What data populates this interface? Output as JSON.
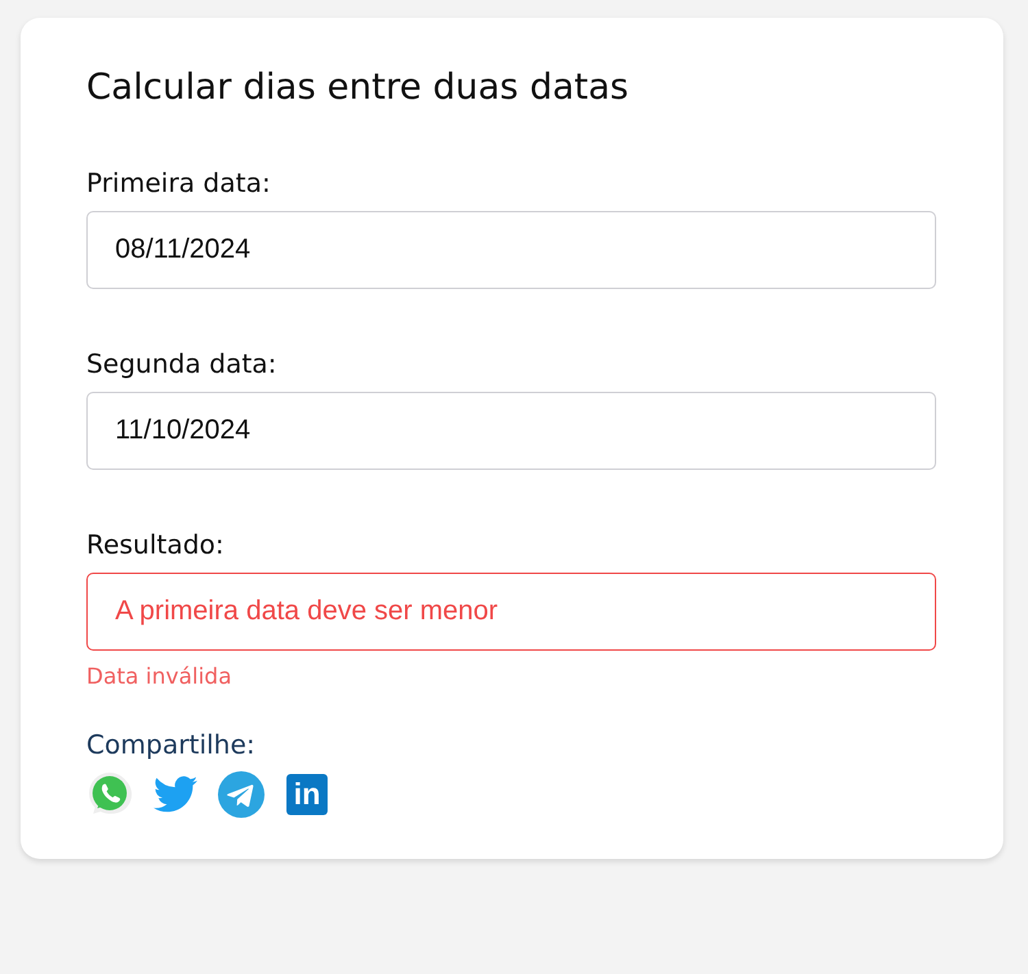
{
  "title": "Calcular dias entre duas datas",
  "fields": [
    {
      "label": "Primeira data:",
      "value": "08/11/2024",
      "invalid": false
    },
    {
      "label": "Segunda data:",
      "value": "11/10/2024",
      "invalid": false
    },
    {
      "label": "Resultado:",
      "value": "A primeira data deve ser menor",
      "invalid": true,
      "error": "Data inválida"
    }
  ],
  "share": {
    "label": "Compartilhe:",
    "icons": [
      {
        "kind": "whatsapp"
      },
      {
        "kind": "twitter"
      },
      {
        "kind": "telegram"
      },
      {
        "kind": "linkedin",
        "text": "in"
      }
    ]
  }
}
